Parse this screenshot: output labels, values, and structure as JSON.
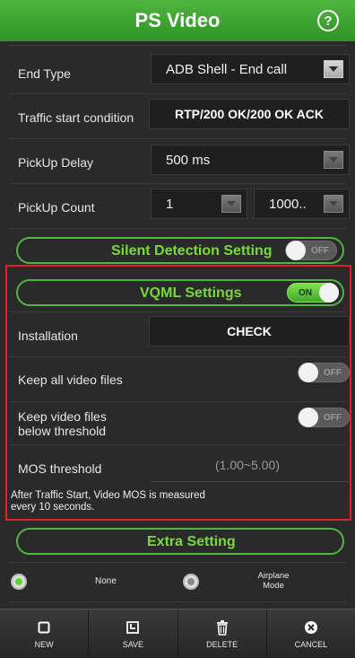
{
  "header": {
    "title": "PS Video",
    "help_icon": "?"
  },
  "end_type": {
    "label": "End Type",
    "value": "ADB Shell - End call"
  },
  "traffic_start": {
    "label": "Traffic start condition",
    "value": "RTP/200 OK/200 OK ACK"
  },
  "pickup_delay": {
    "label": "PickUp Delay",
    "value": "500 ms"
  },
  "pickup_count": {
    "label": "PickUp Count",
    "value1": "1",
    "value2": "1000.."
  },
  "silent_detection": {
    "title": "Silent Detection Setting",
    "toggle": "OFF"
  },
  "vqml": {
    "title": "VQML Settings",
    "toggle": "ON",
    "installation_label": "Installation",
    "installation_button": "CHECK",
    "keep_all_label": "Keep all video files",
    "keep_all_toggle": "OFF",
    "keep_below_label_1": "Keep video files",
    "keep_below_label_2": "below threshold",
    "keep_below_toggle": "OFF",
    "mos_label": "MOS threshold",
    "mos_placeholder": "(1.00~5.00)",
    "note_1": "After Traffic Start, Video MOS is measured",
    "note_2": "every 10 seconds."
  },
  "extra": {
    "title": "Extra Setting"
  },
  "radios": {
    "none_label": "None",
    "airplane_label_1": "Airplane",
    "airplane_label_2": "Mode"
  },
  "toolbar": {
    "new": "NEW",
    "save": "SAVE",
    "delete": "DELETE",
    "cancel": "CANCEL"
  },
  "colors": {
    "header": "#3fa32f",
    "accent": "#7ad93a",
    "highlight_box": "#e0212a"
  }
}
